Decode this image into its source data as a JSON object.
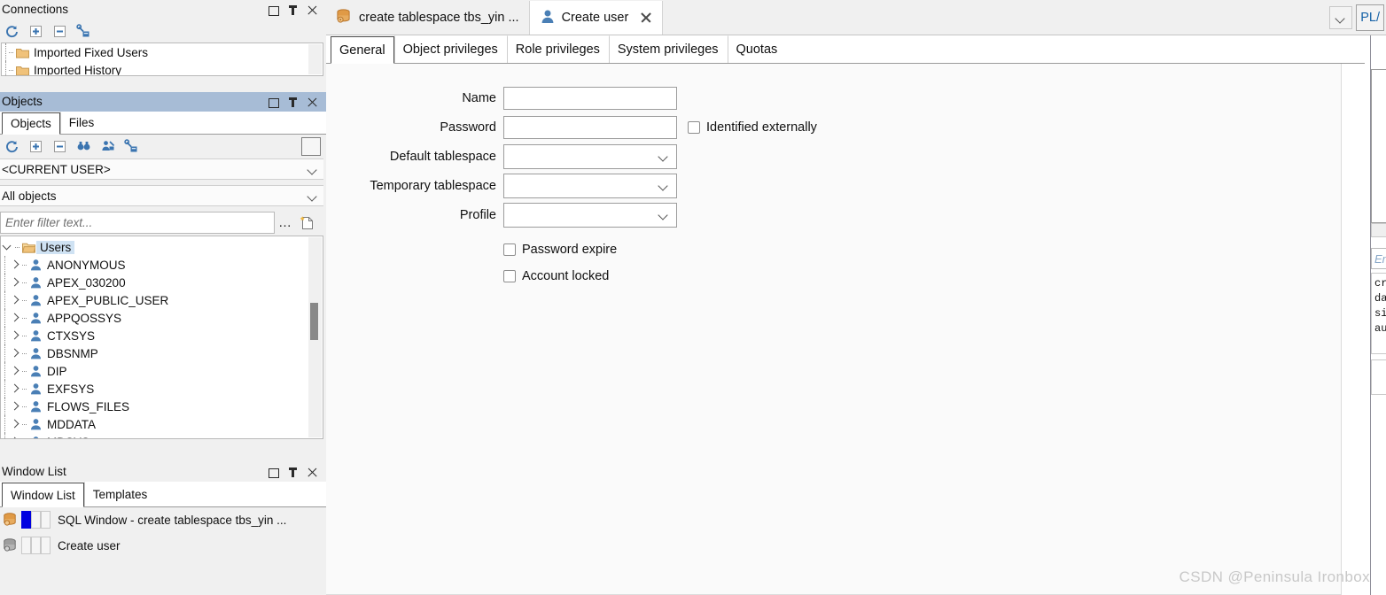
{
  "app": {
    "watermark": "CSDN @Peninsula Ironbox"
  },
  "panels": {
    "connections": {
      "title": "Connections",
      "toolbar": [
        {
          "name": "refresh-icon",
          "tip": "Refresh"
        },
        {
          "name": "expand-all-icon",
          "tip": "Expand all"
        },
        {
          "name": "collapse-all-icon",
          "tip": "Collapse all"
        },
        {
          "name": "configure-connections-icon",
          "tip": "Configure connections"
        }
      ],
      "items": [
        {
          "label": "Imported Fixed Users",
          "icon": "folder-icon"
        },
        {
          "label": "Imported History",
          "icon": "folder-icon"
        }
      ]
    },
    "objects": {
      "title": "Objects",
      "tabs": [
        {
          "label": "Objects",
          "selected": true
        },
        {
          "label": "Files",
          "selected": false
        }
      ],
      "toolbar": [
        {
          "name": "refresh-icon",
          "tip": "Refresh"
        },
        {
          "name": "expand-all-icon",
          "tip": "Expand all"
        },
        {
          "name": "collapse-all-icon",
          "tip": "Collapse all"
        },
        {
          "name": "find-icon",
          "tip": "Find"
        },
        {
          "name": "user-filter-icon",
          "tip": "Browser filter"
        },
        {
          "name": "user-config-icon",
          "tip": "Organize objects"
        }
      ],
      "user_select": "<CURRENT USER>",
      "object_select": "All objects",
      "filter_placeholder": "Enter filter text...",
      "tree": {
        "root": {
          "label": "Users",
          "icon": "folder-open-icon",
          "expanded": true,
          "selected": true
        },
        "children": [
          "ANONYMOUS",
          "APEX_030200",
          "APEX_PUBLIC_USER",
          "APPQOSSYS",
          "CTXSYS",
          "DBSNMP",
          "DIP",
          "EXFSYS",
          "FLOWS_FILES",
          "MDDATA",
          "MDSYS"
        ]
      }
    },
    "window_list": {
      "title": "Window List",
      "tabs": [
        {
          "label": "Window List",
          "selected": true
        },
        {
          "label": "Templates",
          "selected": false
        }
      ],
      "rows": [
        {
          "label": "SQL Window - create tablespace tbs_yin  ...",
          "icon": "sql-window-icon",
          "marker": "blue"
        },
        {
          "label": "Create user",
          "icon": "window-icon",
          "marker": "none"
        }
      ]
    }
  },
  "document_tabs": [
    {
      "label": "create tablespace tbs_yin  ...",
      "icon": "sql-window-icon",
      "active": false,
      "closable": false
    },
    {
      "label": "Create user",
      "icon": "user-icon",
      "active": true,
      "closable": true
    }
  ],
  "tabbar_right": {
    "overflow_icon": "chevron-down-icon",
    "plsql_label": "PL/"
  },
  "main": {
    "sub_tabs": [
      {
        "label": "General",
        "selected": true
      },
      {
        "label": "Object privileges",
        "selected": false
      },
      {
        "label": "Role privileges",
        "selected": false
      },
      {
        "label": "System privileges",
        "selected": false
      },
      {
        "label": "Quotas",
        "selected": false
      }
    ],
    "form": {
      "name": {
        "label": "Name",
        "value": ""
      },
      "password": {
        "label": "Password",
        "value": ""
      },
      "identified_externally": {
        "label": "Identified externally",
        "checked": false
      },
      "default_tablespace": {
        "label": "Default tablespace",
        "value": ""
      },
      "temporary_tablespace": {
        "label": "Temporary tablespace",
        "value": ""
      },
      "profile": {
        "label": "Profile",
        "value": ""
      },
      "password_expire": {
        "label": "Password expire",
        "checked": false
      },
      "account_locked": {
        "label": "Account locked",
        "checked": false
      }
    }
  },
  "right_pane": {
    "filter_placeholder": "En",
    "code_lines": [
      "cr",
      "da",
      "si",
      "au"
    ]
  },
  "colors": {
    "panel_active_title": "#a7bcd6",
    "panel_inactive_title": "#f0f0f0",
    "chrome_bg": "#f0f0f0",
    "tree_selection": "#cfe2f3",
    "icon_blue": "#3a74b0",
    "icon_orange": "#d98229",
    "link_blue": "#1763a8",
    "watermark": "#c8c8c8"
  }
}
